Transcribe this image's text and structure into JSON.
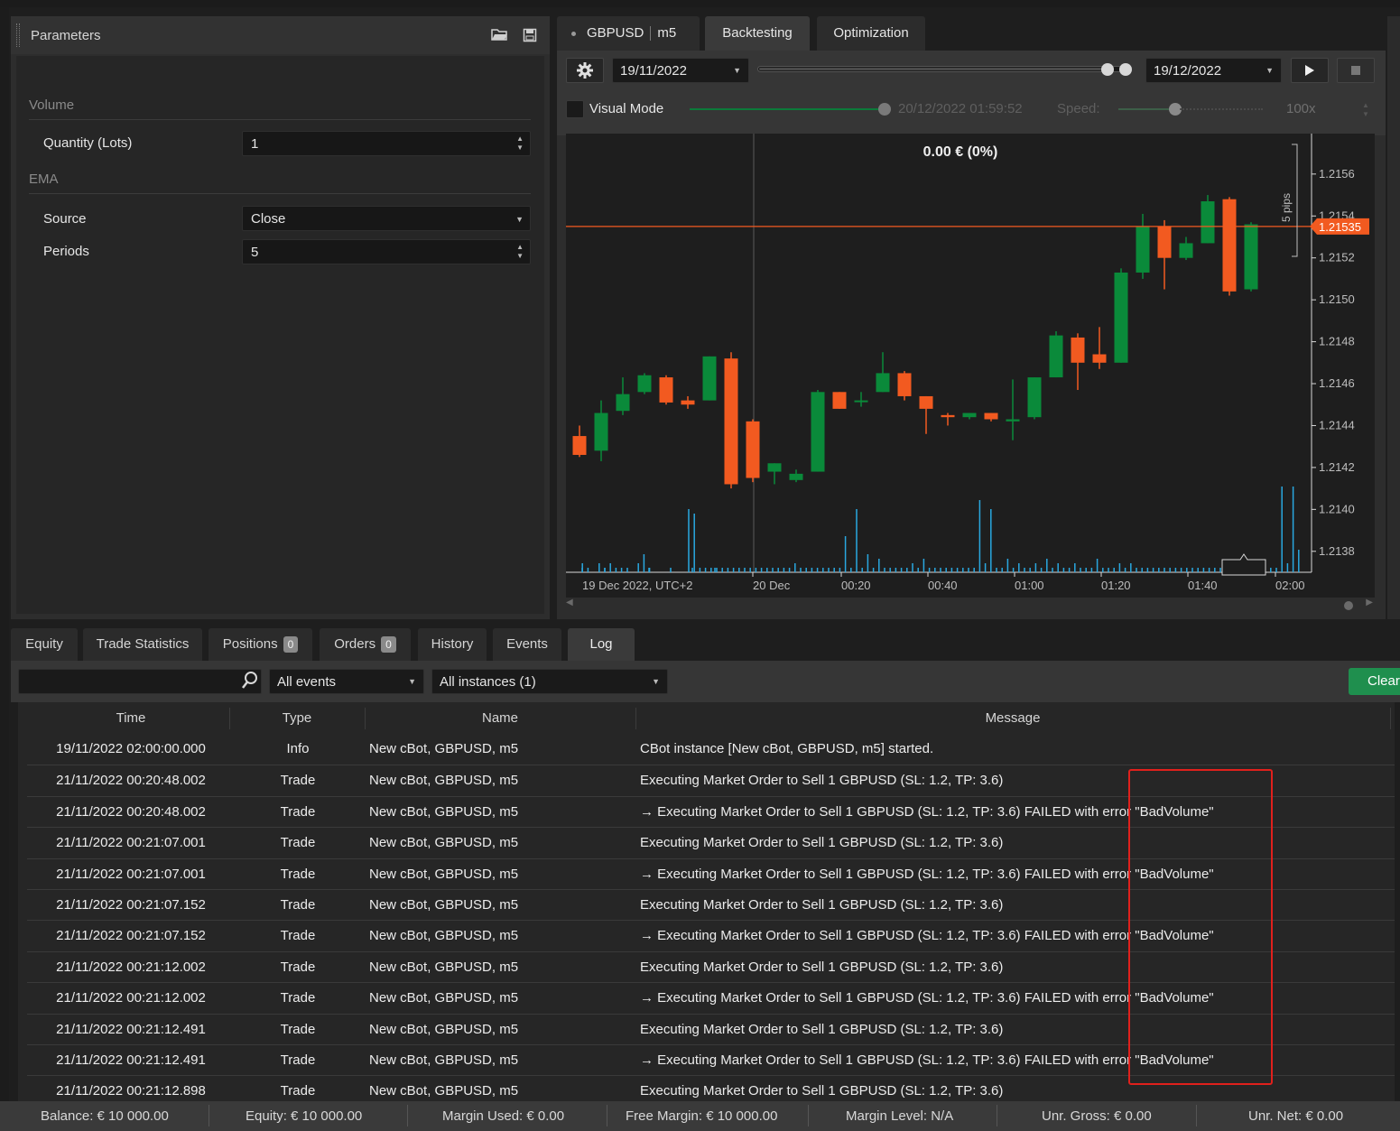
{
  "parameters": {
    "title": "Parameters",
    "sections": [
      {
        "label": "Volume"
      },
      {
        "label": "EMA"
      }
    ],
    "fields": {
      "quantity": {
        "label": "Quantity (Lots)",
        "value": "1"
      },
      "source": {
        "label": "Source",
        "value": "Close"
      },
      "periods": {
        "label": "Periods",
        "value": "5"
      }
    }
  },
  "top_tabs": {
    "symbol": "GBPUSD",
    "timeframe": "m5",
    "backtesting": "Backtesting",
    "optimization": "Optimization"
  },
  "backtest": {
    "start_date": "19/11/2022",
    "end_date": "19/12/2022",
    "visual_mode_label": "Visual Mode",
    "visual_time": "20/12/2022 01:59:52",
    "speed_label": "Speed:",
    "speed_value": "100x"
  },
  "chart": {
    "pnl": "0.00 € (0%)",
    "current_price_label": "1.21535",
    "pips_label": "5 pips",
    "date_caption": "19 Dec 2022, UTC+2",
    "colors": {
      "bull": "#0a8a3a",
      "bear": "#f25a20",
      "price_line": "#f25a20",
      "volume": "#29a8e0",
      "background": "#1e1e1e"
    }
  },
  "chart_data": {
    "type": "candlestick",
    "x_ticks": [
      "20 Dec",
      "00:20",
      "00:40",
      "01:00",
      "01:20",
      "01:40",
      "02:00"
    ],
    "y_ticks": [
      "1.2156",
      "1.2154",
      "1.2152",
      "1.2150",
      "1.2148",
      "1.2146",
      "1.2144",
      "1.2142",
      "1.2140",
      "1.2138"
    ],
    "ylim": [
      1.2137,
      1.21575
    ],
    "current_price": 1.21535,
    "candles": [
      {
        "o": 1.21435,
        "h": 1.2144,
        "l": 1.21425,
        "c": 1.21426
      },
      {
        "o": 1.21428,
        "h": 1.21452,
        "l": 1.21423,
        "c": 1.21446
      },
      {
        "o": 1.21447,
        "h": 1.21463,
        "l": 1.21445,
        "c": 1.21455
      },
      {
        "o": 1.21456,
        "h": 1.21465,
        "l": 1.21455,
        "c": 1.21464
      },
      {
        "o": 1.21463,
        "h": 1.21464,
        "l": 1.2145,
        "c": 1.21451
      },
      {
        "o": 1.21452,
        "h": 1.21454,
        "l": 1.21448,
        "c": 1.2145
      },
      {
        "o": 1.21452,
        "h": 1.21473,
        "l": 1.21452,
        "c": 1.21473
      },
      {
        "o": 1.21472,
        "h": 1.21475,
        "l": 1.2141,
        "c": 1.21412
      },
      {
        "o": 1.21442,
        "h": 1.21443,
        "l": 1.21413,
        "c": 1.21415
      },
      {
        "o": 1.21418,
        "h": 1.21422,
        "l": 1.21412,
        "c": 1.21422
      },
      {
        "o": 1.21414,
        "h": 1.21419,
        "l": 1.21413,
        "c": 1.21417
      },
      {
        "o": 1.21418,
        "h": 1.21457,
        "l": 1.21418,
        "c": 1.21456
      },
      {
        "o": 1.21456,
        "h": 1.21456,
        "l": 1.21448,
        "c": 1.21448
      },
      {
        "o": 1.21452,
        "h": 1.21456,
        "l": 1.21449,
        "c": 1.21452
      },
      {
        "o": 1.21456,
        "h": 1.21475,
        "l": 1.21456,
        "c": 1.21465
      },
      {
        "o": 1.21465,
        "h": 1.21466,
        "l": 1.21452,
        "c": 1.21454
      },
      {
        "o": 1.21454,
        "h": 1.21454,
        "l": 1.21436,
        "c": 1.21448
      },
      {
        "o": 1.21445,
        "h": 1.21446,
        "l": 1.2144,
        "c": 1.21444
      },
      {
        "o": 1.21444,
        "h": 1.21446,
        "l": 1.21443,
        "c": 1.21446
      },
      {
        "o": 1.21446,
        "h": 1.21446,
        "l": 1.21442,
        "c": 1.21443
      },
      {
        "o": 1.21442,
        "h": 1.21462,
        "l": 1.21433,
        "c": 1.21443
      },
      {
        "o": 1.21444,
        "h": 1.21463,
        "l": 1.21443,
        "c": 1.21463
      },
      {
        "o": 1.21463,
        "h": 1.21485,
        "l": 1.21463,
        "c": 1.21483
      },
      {
        "o": 1.21482,
        "h": 1.21484,
        "l": 1.21457,
        "c": 1.2147
      },
      {
        "o": 1.21474,
        "h": 1.21487,
        "l": 1.21467,
        "c": 1.2147
      },
      {
        "o": 1.2147,
        "h": 1.21515,
        "l": 1.2147,
        "c": 1.21513
      },
      {
        "o": 1.21513,
        "h": 1.21541,
        "l": 1.2151,
        "c": 1.21535
      },
      {
        "o": 1.21535,
        "h": 1.21538,
        "l": 1.21505,
        "c": 1.2152
      },
      {
        "o": 1.2152,
        "h": 1.2153,
        "l": 1.21519,
        "c": 1.21527
      },
      {
        "o": 1.21527,
        "h": 1.2155,
        "l": 1.21527,
        "c": 1.21547
      },
      {
        "o": 1.21548,
        "h": 1.21549,
        "l": 1.21502,
        "c": 1.21504
      },
      {
        "o": 1.21505,
        "h": 1.21537,
        "l": 1.21504,
        "c": 1.21536
      }
    ],
    "volumes": [
      0,
      2,
      1,
      0,
      2,
      1,
      2,
      1,
      1,
      0,
      0,
      2,
      4,
      1,
      0,
      0,
      0,
      0,
      0,
      0,
      14,
      13,
      1,
      1,
      1,
      1,
      1,
      1,
      1,
      1,
      1,
      1,
      1,
      1,
      1,
      1,
      1,
      1,
      1,
      2,
      1,
      1,
      1,
      1,
      1,
      1,
      1,
      1,
      8,
      1,
      14,
      1,
      4,
      1,
      3,
      1,
      1,
      1,
      1,
      1,
      2,
      1,
      3,
      1,
      1,
      1,
      1,
      1,
      1,
      1,
      1,
      1,
      16,
      2,
      14,
      1,
      1,
      3,
      1,
      2,
      1,
      1,
      2,
      1,
      3,
      1,
      2,
      1,
      1,
      2,
      1,
      1,
      1,
      3,
      1,
      1,
      1,
      2,
      1,
      2,
      1,
      1,
      1,
      1,
      1,
      1,
      1,
      1,
      1,
      1,
      1,
      1,
      1,
      1,
      1,
      1,
      1,
      1,
      1,
      1,
      1,
      1,
      1,
      1,
      1,
      1,
      19,
      2,
      19,
      5
    ]
  },
  "bottom_tabs": {
    "equity": "Equity",
    "trade_statistics": "Trade Statistics",
    "positions": "Positions",
    "positions_count": "0",
    "orders": "Orders",
    "orders_count": "0",
    "history": "History",
    "events": "Events",
    "log": "Log"
  },
  "filters": {
    "search_placeholder": "",
    "event_filter": "All events",
    "instance_filter": "All instances (1)",
    "clear_label": "Clear"
  },
  "log": {
    "columns": [
      "Time",
      "Type",
      "Name",
      "Message"
    ],
    "rows": [
      {
        "time": "19/11/2022 02:00:00.000",
        "type": "Info",
        "name": "New cBot, GBPUSD, m5",
        "message": "CBot instance [New cBot, GBPUSD, m5] started."
      },
      {
        "time": "21/11/2022 00:20:48.002",
        "type": "Trade",
        "name": "New cBot, GBPUSD, m5",
        "message": "Executing Market Order to Sell 1 GBPUSD (SL: 1.2, TP: 3.6)"
      },
      {
        "time": "21/11/2022 00:20:48.002",
        "type": "Trade",
        "name": "New cBot, GBPUSD, m5",
        "message": "→ Executing Market Order to Sell 1 GBPUSD (SL: 1.2, TP: 3.6) FAILED with error \"BadVolume\""
      },
      {
        "time": "21/11/2022 00:21:07.001",
        "type": "Trade",
        "name": "New cBot, GBPUSD, m5",
        "message": "Executing Market Order to Sell 1 GBPUSD (SL: 1.2, TP: 3.6)"
      },
      {
        "time": "21/11/2022 00:21:07.001",
        "type": "Trade",
        "name": "New cBot, GBPUSD, m5",
        "message": "→ Executing Market Order to Sell 1 GBPUSD (SL: 1.2, TP: 3.6) FAILED with error \"BadVolume\""
      },
      {
        "time": "21/11/2022 00:21:07.152",
        "type": "Trade",
        "name": "New cBot, GBPUSD, m5",
        "message": "Executing Market Order to Sell 1 GBPUSD (SL: 1.2, TP: 3.6)"
      },
      {
        "time": "21/11/2022 00:21:07.152",
        "type": "Trade",
        "name": "New cBot, GBPUSD, m5",
        "message": "→ Executing Market Order to Sell 1 GBPUSD (SL: 1.2, TP: 3.6) FAILED with error \"BadVolume\""
      },
      {
        "time": "21/11/2022 00:21:12.002",
        "type": "Trade",
        "name": "New cBot, GBPUSD, m5",
        "message": "Executing Market Order to Sell 1 GBPUSD (SL: 1.2, TP: 3.6)"
      },
      {
        "time": "21/11/2022 00:21:12.002",
        "type": "Trade",
        "name": "New cBot, GBPUSD, m5",
        "message": "→ Executing Market Order to Sell 1 GBPUSD (SL: 1.2, TP: 3.6) FAILED with error \"BadVolume\""
      },
      {
        "time": "21/11/2022 00:21:12.491",
        "type": "Trade",
        "name": "New cBot, GBPUSD, m5",
        "message": "Executing Market Order to Sell 1 GBPUSD (SL: 1.2, TP: 3.6)"
      },
      {
        "time": "21/11/2022 00:21:12.491",
        "type": "Trade",
        "name": "New cBot, GBPUSD, m5",
        "message": "→ Executing Market Order to Sell 1 GBPUSD (SL: 1.2, TP: 3.6) FAILED with error \"BadVolume\""
      },
      {
        "time": "21/11/2022 00:21:12.898",
        "type": "Trade",
        "name": "New cBot, GBPUSD, m5",
        "message": "Executing Market Order to Sell 1 GBPUSD (SL: 1.2, TP: 3.6)"
      }
    ]
  },
  "status": {
    "balance": "Balance: € 10 000.00",
    "equity": "Equity: € 10 000.00",
    "margin_used": "Margin Used: € 0.00",
    "free_margin": "Free Margin: € 10 000.00",
    "margin_level": "Margin Level: N/A",
    "unr_gross": "Unr. Gross: € 0.00",
    "unr_net": "Unr. Net: € 0.00"
  },
  "icons": [
    "gear-icon",
    "play-icon",
    "stop-icon",
    "search-icon",
    "folder-icon",
    "save-icon"
  ]
}
